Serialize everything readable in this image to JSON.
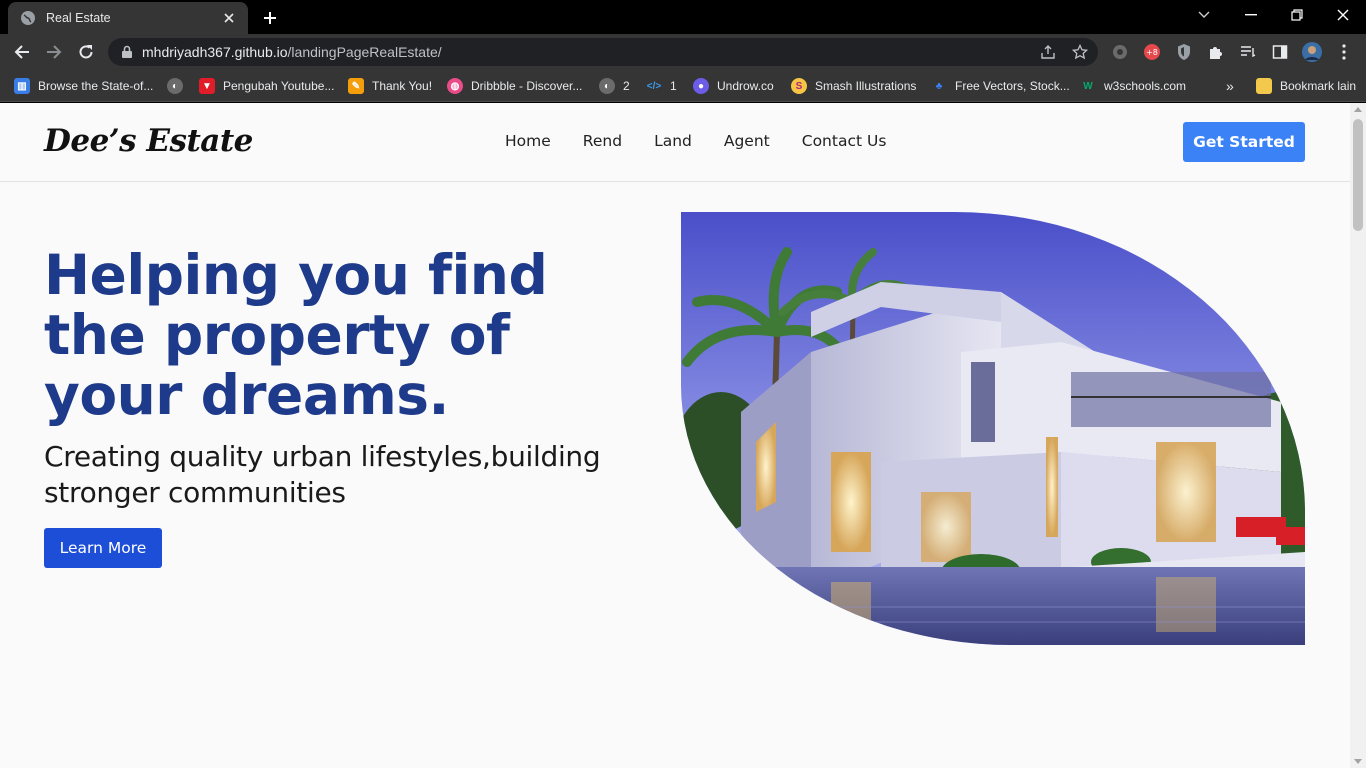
{
  "browser": {
    "tab_title": "Real Estate",
    "url_host": "mhdriyadh367.github.io",
    "url_path": "/landingPageRealEstate/",
    "bookmarks": [
      "Browse the State-of...",
      "Pengubah Youtube...",
      "Thank You!",
      "Dribbble - Discover...",
      "2",
      "1",
      "Undrow.co",
      "Smash Illustrations",
      "Free Vectors, Stock...",
      "w3schools.com"
    ],
    "bookmarks_overflow": "»",
    "other_bookmarks": "Bookmark lain"
  },
  "site": {
    "logo": "Dee’s Estate",
    "nav": [
      "Home",
      "Rend",
      "Land",
      "Agent",
      "Contact Us"
    ],
    "cta_label": "Get Started"
  },
  "hero": {
    "title": "Helping you find the property of your dreams.",
    "subtitle": "Creating quality urban lifestyles,building stronger communities",
    "button_label": "Learn More"
  },
  "colors": {
    "brand_blue": "#1e3a8a",
    "cta_blue": "#3b82f6",
    "button_blue": "#1d4ed8"
  }
}
